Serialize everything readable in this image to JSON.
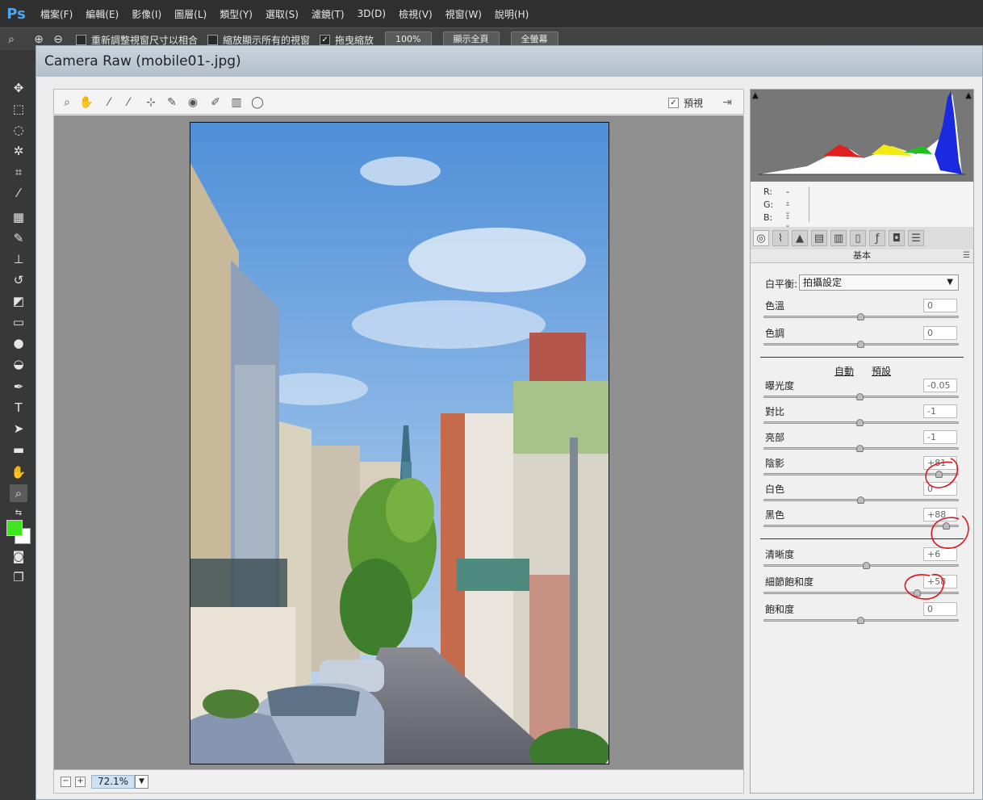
{
  "app": {
    "logo": "Ps",
    "menu": [
      "檔案(F)",
      "編輯(E)",
      "影像(I)",
      "圖層(L)",
      "類型(Y)",
      "選取(S)",
      "濾鏡(T)",
      "3D(D)",
      "檢視(V)",
      "視窗(W)",
      "說明(H)"
    ]
  },
  "options_bar": {
    "resize_windows": "重新調整視窗尺寸以相合",
    "zoom_all_windows": "縮放顯示所有的視窗",
    "scrubby_zoom": "拖曳縮放",
    "btn_100": "100%",
    "btn_fit": "顯示全頁",
    "btn_fill": "全螢幕"
  },
  "dialog": {
    "title": "Camera Raw (mobile01-.jpg)",
    "preview_label": "預視",
    "zoom": "72.1%"
  },
  "histogram": {
    "r_label": "R:",
    "g_label": "G:",
    "b_label": "B:",
    "r_value": "---",
    "g_value": "---",
    "b_value": "---"
  },
  "panel": {
    "title": "基本",
    "white_balance_label": "白平衡:",
    "white_balance_value": "拍攝設定",
    "auto_label": "自動",
    "default_label": "預設",
    "sliders": [
      {
        "label": "色溫",
        "value": "0",
        "pos": 0.5
      },
      {
        "label": "色調",
        "value": "0",
        "pos": 0.5
      },
      {
        "label": "曝光度",
        "value": "-0.05",
        "pos": 0.495
      },
      {
        "label": "對比",
        "value": "-1",
        "pos": 0.495
      },
      {
        "label": "亮部",
        "value": "-1",
        "pos": 0.495
      },
      {
        "label": "陰影",
        "value": "+81",
        "pos": 0.905
      },
      {
        "label": "白色",
        "value": "0",
        "pos": 0.5
      },
      {
        "label": "黑色",
        "value": "+88",
        "pos": 0.94
      },
      {
        "label": "清晰度",
        "value": "+6",
        "pos": 0.53
      },
      {
        "label": "細節飽和度",
        "value": "+58",
        "pos": 0.79
      },
      {
        "label": "飽和度",
        "value": "0",
        "pos": 0.5
      }
    ]
  },
  "colors": {
    "foreground": "#3ee61c",
    "background": "#ffffff"
  }
}
